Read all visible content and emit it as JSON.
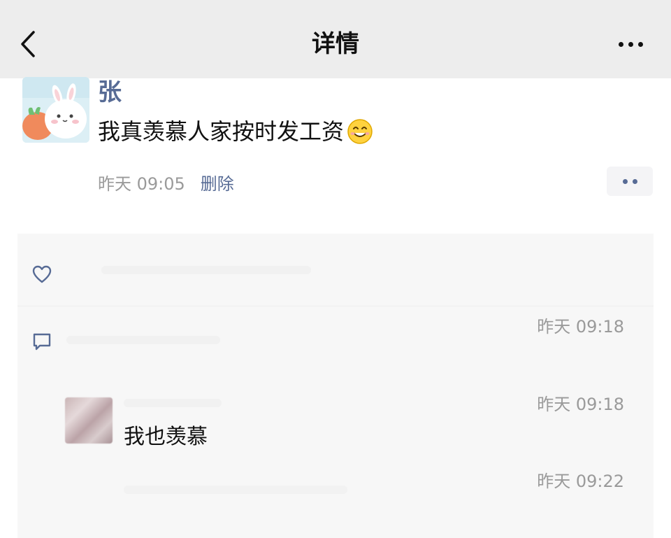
{
  "nav": {
    "title": "详情"
  },
  "post": {
    "author": "张",
    "text": "我真羡慕人家按时发工资",
    "time": "昨天 09:05",
    "delete_label": "删除"
  },
  "interactions": {
    "comments": [
      {
        "time": "昨天 09:18",
        "text": ""
      },
      {
        "time": "昨天 09:18",
        "text": "我也羡慕"
      },
      {
        "time": "昨天 09:22",
        "text": ""
      }
    ]
  },
  "colors": {
    "nav_bg": "#ededed",
    "name_link": "#576b95",
    "panel_bg": "#f7f7f7",
    "meta_text": "#9a9a9a"
  }
}
